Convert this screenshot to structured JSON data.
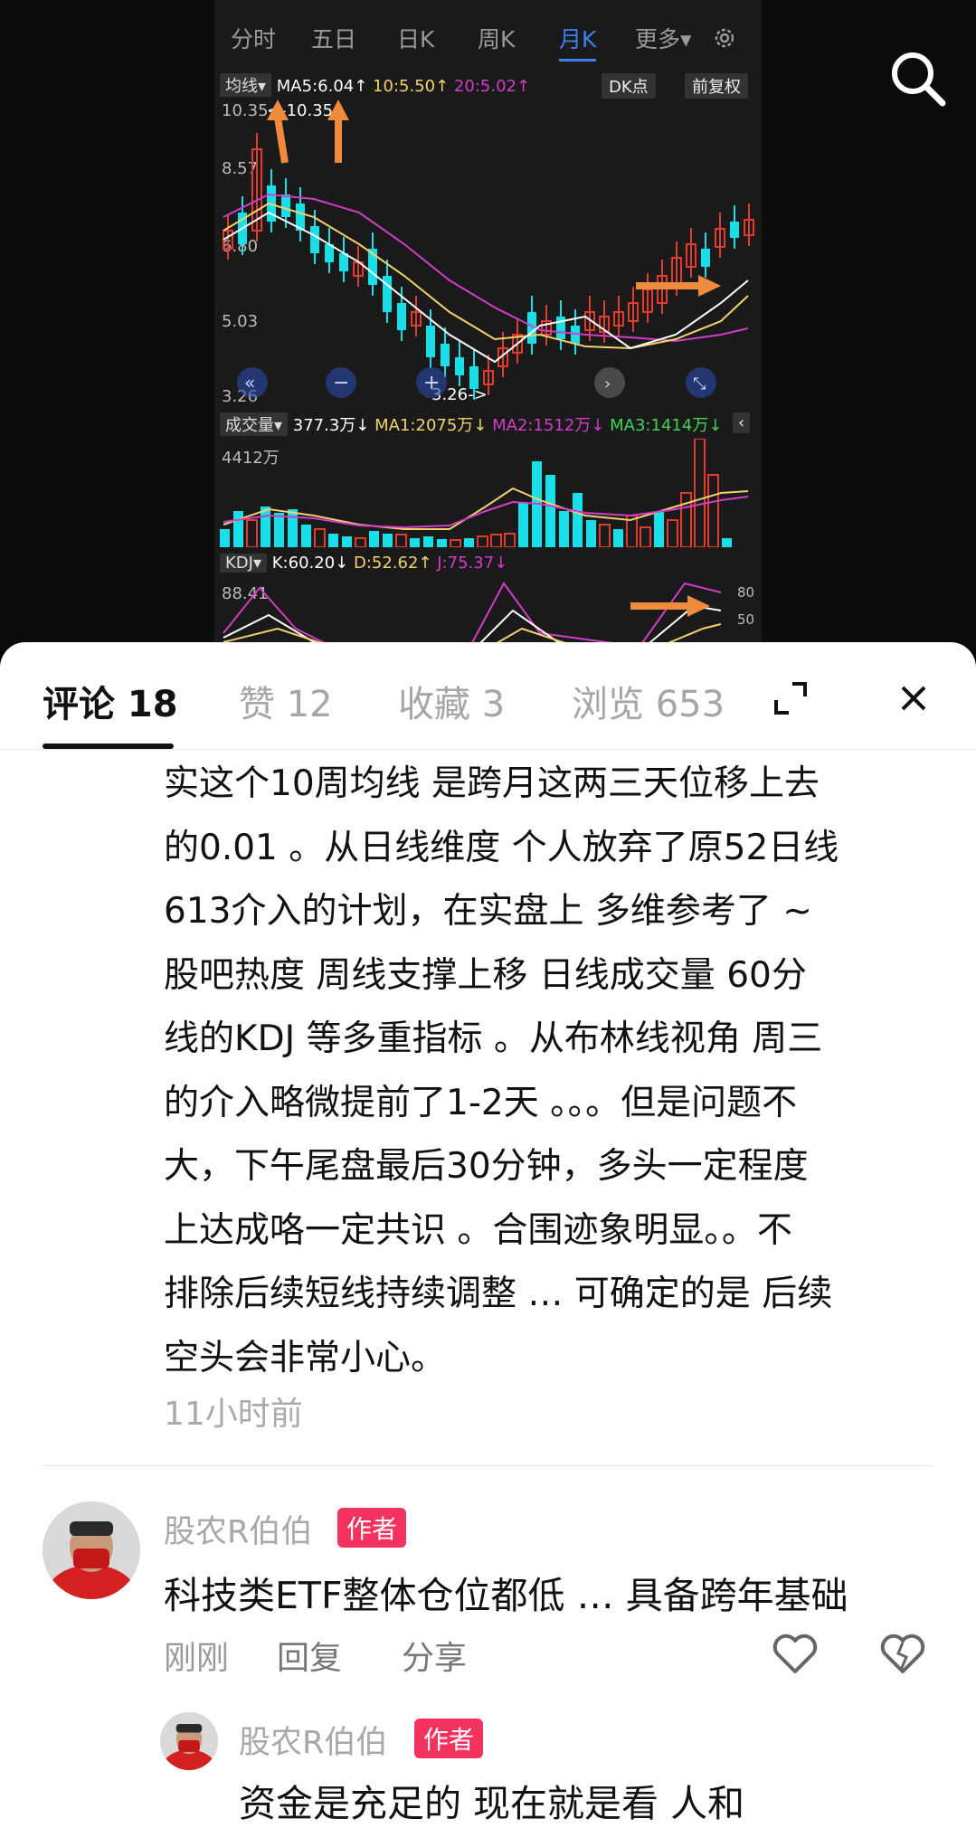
{
  "chart_header": {
    "tabs": [
      "分时",
      "五日",
      "日K",
      "周K",
      "月K",
      "更多▾"
    ],
    "active_tab": "月K",
    "ma_selector": "均线▾",
    "ma5": "MA5:6.04↑",
    "ma10": "10:5.50↑",
    "ma20": "20:5.02↑",
    "dk_button": "DK点",
    "fq_button": "前复权"
  },
  "price_axis": {
    "high_label": "10.35",
    "high_marker": "<-10.35",
    "y1": "8.57",
    "y2": "6.80",
    "y3": "5.03",
    "low_label": "3.26",
    "low_marker": "3.26->"
  },
  "volume": {
    "selector": "成交量▾",
    "vol": "377.3万↓",
    "ma1": "MA1:2075万↓",
    "ma2": "MA2:1512万↓",
    "ma3": "MA3:1414万↓",
    "max_label": "4412万"
  },
  "kdj": {
    "selector": "KDJ▾",
    "k": "K:60.20↓",
    "d": "D:52.62↑",
    "j": "J:75.37↓",
    "max_label": "88.41",
    "r80": "80",
    "r50": "50"
  },
  "colors": {
    "up": "#e23b2e",
    "down": "#19e0e8",
    "ma5": "#ffffff",
    "ma10": "#f2d36b",
    "ma20": "#d23cc8",
    "accent": "#3b7ff0",
    "arrow": "#f08a3c",
    "badge": "#f4325e"
  },
  "panel": {
    "tabs": [
      {
        "label": "评论 18"
      },
      {
        "label": "赞 12"
      },
      {
        "label": "收藏 3"
      },
      {
        "label": "浏览 653"
      }
    ]
  },
  "comment": {
    "lines": [
      "实这个10周均线 是跨月这两三天位移上去",
      "的0.01 。从日线维度 个人放弃了原52日线",
      "613介入的计划，在实盘上 多维参考了 ~",
      "股吧热度 周线支撑上移 日线成交量 60分",
      "线的KDJ 等多重指标 。从布林线视角 周三",
      "的介入略微提前了1-2天 。。。但是问题不",
      "大，下午尾盘最后30分钟，多头一定程度",
      "上达成咯一定共识 。合围迹象明显。。不",
      "排除后续短线持续调整 … 可确定的是 后续",
      "空头会非常小心。"
    ],
    "time": "11小时前"
  },
  "reply1": {
    "user": "股农R伯伯",
    "badge": "作者",
    "text": "科技类ETF整体仓位都低 … 具备跨年基础",
    "time": "刚刚",
    "reply_btn": "回复",
    "share_btn": "分享"
  },
  "reply2": {
    "user": "股农R伯伯",
    "badge": "作者",
    "text": "资金是充足的 现在就是看 人和"
  }
}
